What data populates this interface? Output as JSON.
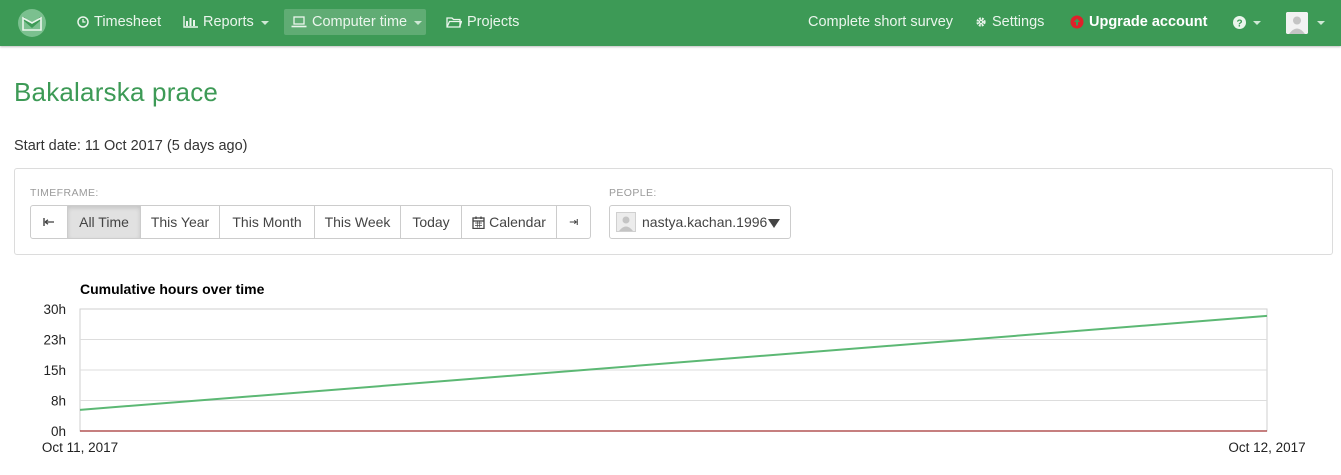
{
  "nav": {
    "timesheet": "Timesheet",
    "reports": "Reports",
    "computer_time": "Computer time",
    "projects": "Projects",
    "survey": "Complete short survey",
    "settings": "Settings",
    "upgrade": "Upgrade account",
    "upgrade_icon_color": "#e0202a"
  },
  "page": {
    "title": "Bakalarska prace",
    "start_date": "Start date: 11 Oct 2017 (5 days ago)"
  },
  "filters": {
    "timeframe_label": "TIMEFRAME:",
    "timeframe_buttons": [
      "All Time",
      "This Year",
      "This Month",
      "This Week",
      "Today",
      "Calendar"
    ],
    "active": "All Time",
    "people_label": "PEOPLE:",
    "people_value": "nastya.kachan.1996"
  },
  "chart_data": {
    "type": "line",
    "title": "Cumulative hours over time",
    "x_labels": [
      "Oct 11, 2017",
      "Oct 12, 2017"
    ],
    "y_ticks": [
      "0h",
      "8h",
      "15h",
      "23h",
      "30h"
    ],
    "ylim": [
      0,
      30
    ],
    "grid": true,
    "series": [
      {
        "values": [
          5.2,
          28.3
        ],
        "color": "#5cb874"
      },
      {
        "values": [
          0,
          0
        ],
        "color": "#a33333"
      }
    ]
  }
}
